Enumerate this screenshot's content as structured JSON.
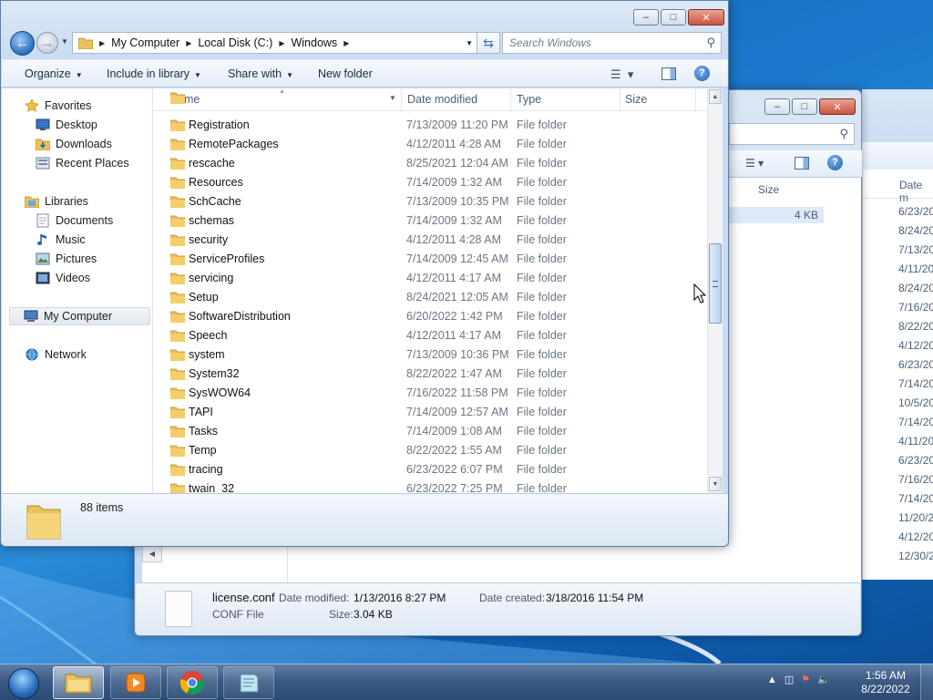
{
  "main_window": {
    "address": {
      "crumbs": [
        "My Computer",
        "Local Disk (C:)",
        "Windows"
      ]
    },
    "search": {
      "placeholder": "Search Windows"
    },
    "toolbar": {
      "organize": "Organize",
      "include_in_library": "Include in library",
      "share_with": "Share with",
      "new_folder": "New folder"
    },
    "nav": {
      "favorites": "Favorites",
      "desktop": "Desktop",
      "downloads": "Downloads",
      "recent_places": "Recent Places",
      "libraries": "Libraries",
      "documents": "Documents",
      "music": "Music",
      "pictures": "Pictures",
      "videos": "Videos",
      "my_computer": "My Computer",
      "network": "Network"
    },
    "columns": {
      "name": "Name",
      "date_modified": "Date modified",
      "type": "Type",
      "size": "Size"
    },
    "files": [
      {
        "name": "Registration",
        "date": "7/13/2009 11:20 PM",
        "type": "File folder"
      },
      {
        "name": "RemotePackages",
        "date": "4/12/2011 4:28 AM",
        "type": "File folder"
      },
      {
        "name": "rescache",
        "date": "8/25/2021 12:04 AM",
        "type": "File folder"
      },
      {
        "name": "Resources",
        "date": "7/14/2009 1:32 AM",
        "type": "File folder"
      },
      {
        "name": "SchCache",
        "date": "7/13/2009 10:35 PM",
        "type": "File folder"
      },
      {
        "name": "schemas",
        "date": "7/14/2009 1:32 AM",
        "type": "File folder"
      },
      {
        "name": "security",
        "date": "4/12/2011 4:28 AM",
        "type": "File folder"
      },
      {
        "name": "ServiceProfiles",
        "date": "7/14/2009 12:45 AM",
        "type": "File folder"
      },
      {
        "name": "servicing",
        "date": "4/12/2011 4:17 AM",
        "type": "File folder"
      },
      {
        "name": "Setup",
        "date": "8/24/2021 12:05 AM",
        "type": "File folder"
      },
      {
        "name": "SoftwareDistribution",
        "date": "6/20/2022 1:42 PM",
        "type": "File folder"
      },
      {
        "name": "Speech",
        "date": "4/12/2011 4:17 AM",
        "type": "File folder"
      },
      {
        "name": "system",
        "date": "7/13/2009 10:36 PM",
        "type": "File folder"
      },
      {
        "name": "System32",
        "date": "8/22/2022 1:47 AM",
        "type": "File folder"
      },
      {
        "name": "SysWOW64",
        "date": "7/16/2022 11:58 PM",
        "type": "File folder"
      },
      {
        "name": "TAPI",
        "date": "7/14/2009 12:57 AM",
        "type": "File folder"
      },
      {
        "name": "Tasks",
        "date": "7/14/2009 1:08 AM",
        "type": "File folder"
      },
      {
        "name": "Temp",
        "date": "8/22/2022 1:55 AM",
        "type": "File folder"
      },
      {
        "name": "tracing",
        "date": "6/23/2022 6:07 PM",
        "type": "File folder"
      },
      {
        "name": "twain_32",
        "date": "6/23/2022 7:25 PM",
        "type": "File folder"
      }
    ],
    "status": {
      "item_count": "88 items"
    }
  },
  "background_window": {
    "size_header": "Size",
    "size_value": "4 KB",
    "details": {
      "name": "license.conf",
      "type": "CONF File",
      "modified_label": "Date modified:",
      "modified_value": "1/13/2016 8:27 PM",
      "created_label": "Date created:",
      "created_value": "3/18/2016 11:54 PM",
      "size_label": "Size:",
      "size_value": "3.04 KB"
    }
  },
  "far_window": {
    "header": "Date m",
    "dates": [
      "6/23/20",
      "8/24/20",
      "7/13/20",
      "4/11/20",
      "8/24/20",
      "7/16/20",
      "8/22/20",
      "4/12/20",
      "6/23/20",
      "7/14/20",
      "10/5/20",
      "7/14/20",
      "4/11/20",
      "6/23/20",
      "7/16/20",
      "7/14/20",
      "11/20/2",
      "4/12/20",
      "12/30/2"
    ]
  },
  "taskbar": {
    "clock_time": "1:56 AM",
    "clock_date": "8/22/2022"
  },
  "colors": {
    "accent": "#2a6fc1",
    "folder_yellow": "#e8c25a",
    "taskbar": "#3b5a85"
  },
  "icons": [
    "back-arrow-icon",
    "forward-arrow-icon",
    "folder-icon",
    "refresh-icon",
    "search-icon",
    "views-icon",
    "preview-pane-icon",
    "help-icon",
    "star-icon",
    "desktop-icon",
    "downloads-icon",
    "recent-places-icon",
    "library-icon",
    "documents-icon",
    "music-icon",
    "pictures-icon",
    "videos-icon",
    "computer-icon",
    "network-icon",
    "file-icon",
    "mouse-cursor-icon"
  ]
}
